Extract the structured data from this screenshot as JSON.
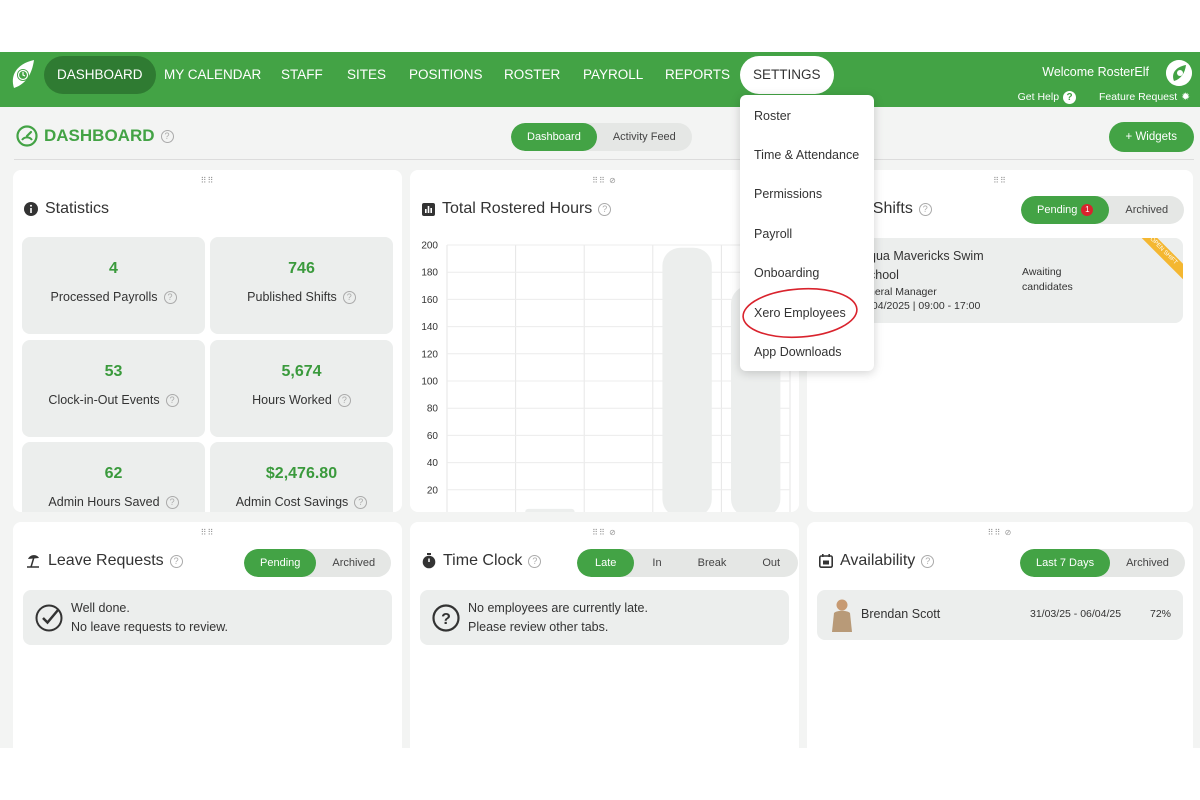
{
  "nav": {
    "items": [
      "DASHBOARD",
      "MY CALENDAR",
      "STAFF",
      "SITES",
      "POSITIONS",
      "ROSTER",
      "PAYROLL",
      "REPORTS",
      "SETTINGS"
    ],
    "welcome": "Welcome RosterElf",
    "get_help": "Get Help",
    "feature_request": "Feature Request"
  },
  "page": {
    "title": "DASHBOARD",
    "view_tabs": [
      "Dashboard",
      "Activity Feed"
    ],
    "widgets_button": "+ Widgets"
  },
  "settings_menu": [
    "Roster",
    "Time & Attendance",
    "Permissions",
    "Payroll",
    "Onboarding",
    "Xero Employees",
    "App Downloads"
  ],
  "statistics": {
    "title": "Statistics",
    "items": [
      {
        "value": "4",
        "label": "Processed Payrolls"
      },
      {
        "value": "746",
        "label": "Published Shifts"
      },
      {
        "value": "53",
        "label": "Clock-in-Out Events"
      },
      {
        "value": "5,674",
        "label": "Hours Worked"
      },
      {
        "value": "62",
        "label": "Admin Hours Saved"
      },
      {
        "value": "$2,476.80",
        "label": "Admin Cost Savings"
      }
    ]
  },
  "rostered_hours": {
    "title": "Total Rostered Hours",
    "y_ticks": [
      "200",
      "180",
      "160",
      "140",
      "120",
      "100",
      "80",
      "60",
      "40",
      "20"
    ]
  },
  "chart_data": {
    "type": "bar",
    "title": "Total Rostered Hours",
    "ylim": [
      0,
      200
    ],
    "y_ticks": [
      20,
      40,
      60,
      80,
      100,
      120,
      140,
      160,
      180,
      200
    ],
    "values": [
      2,
      6,
      0,
      198,
      170
    ],
    "grid": true
  },
  "open_shifts": {
    "title": "ing Shifts",
    "tabs": [
      "Pending",
      "Archived"
    ],
    "pending_count": "1",
    "shift": {
      "site": "qua Mavericks Swim",
      "site2": "chool",
      "position": "neral Manager",
      "time": "/04/2025 | 09:00 - 17:00",
      "status1": "Awaiting",
      "status2": "candidates",
      "ribbon": "OPEN SHIFT"
    }
  },
  "leave_requests": {
    "title": "Leave Requests",
    "tabs": [
      "Pending",
      "Archived"
    ],
    "line1": "Well done.",
    "line2": "No leave requests to review."
  },
  "time_clock": {
    "title": "Time Clock",
    "tabs": [
      "Late",
      "In",
      "Break",
      "Out"
    ],
    "line1": "No employees are currently late.",
    "line2": "Please review other tabs."
  },
  "availability": {
    "title": "Availability",
    "tabs": [
      "Last 7 Days",
      "Archived"
    ],
    "row": {
      "name": "Brendan Scott",
      "range": "31/03/25 - 06/04/25",
      "pct": "72%"
    }
  },
  "colors": {
    "brand": "#43a345",
    "brand_dark": "#2f7b32",
    "annotation": "#d9232d"
  }
}
